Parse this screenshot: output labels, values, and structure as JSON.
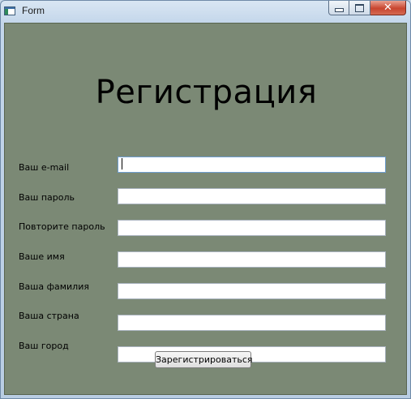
{
  "window": {
    "title": "Form",
    "minimize_icon": "minimize-icon",
    "maximize_icon": "maximize-icon",
    "close_icon": "close-icon",
    "close_glyph": "✕"
  },
  "form": {
    "heading": "Регистрация",
    "fields": [
      {
        "label": "Ваш e-mail",
        "value": ""
      },
      {
        "label": "Ваш пароль",
        "value": ""
      },
      {
        "label": "Повторите пароль",
        "value": ""
      },
      {
        "label": "Ваше имя",
        "value": ""
      },
      {
        "label": "Ваша фамилия",
        "value": ""
      },
      {
        "label": "Ваша страна",
        "value": ""
      },
      {
        "label": "Ваш город",
        "value": ""
      }
    ],
    "submit_label": "Зарегистрироваться"
  },
  "colors": {
    "form_background": "#7b8975",
    "input_background": "#ffffff"
  }
}
